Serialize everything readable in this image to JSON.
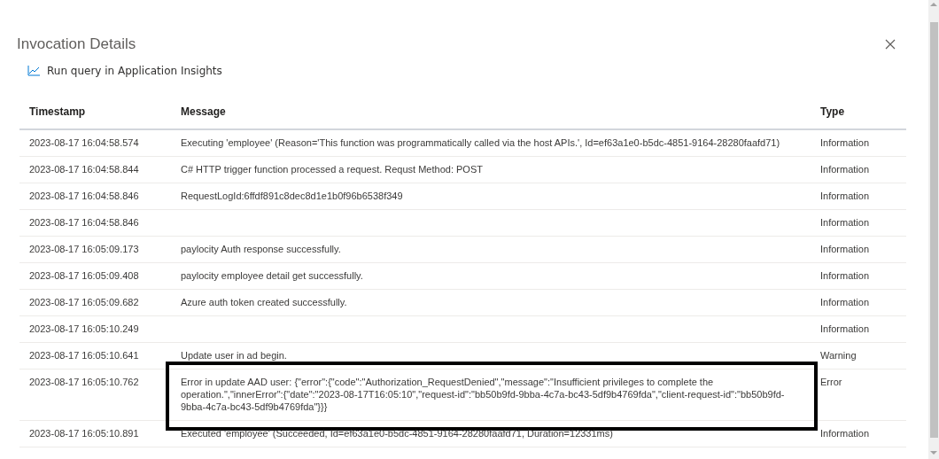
{
  "panel": {
    "title": "Invocation Details",
    "action": "Run query in Application Insights"
  },
  "table": {
    "columns": [
      "Timestamp",
      "Message",
      "Type"
    ],
    "rows": [
      {
        "timestamp": "2023-08-17 16:04:58.574",
        "message": "Executing 'employee' (Reason='This function was programmatically called via the host APIs.', Id=ef63a1e0-b5dc-4851-9164-28280faafd71)",
        "type": "Information",
        "highlighted": false
      },
      {
        "timestamp": "2023-08-17 16:04:58.844",
        "message": "C# HTTP trigger function processed a request. Requst Method: POST",
        "type": "Information",
        "highlighted": false
      },
      {
        "timestamp": "2023-08-17 16:04:58.846",
        "message": "RequestLogId:6ffdf891c8dec8d1e1b0f96b6538f349",
        "type": "Information",
        "highlighted": false
      },
      {
        "timestamp": "2023-08-17 16:04:58.846",
        "type": "Information",
        "highlighted": false
      },
      {
        "timestamp": "2023-08-17 16:05:09.173",
        "message": "paylocity Auth response successfully.",
        "type": "Information",
        "highlighted": false
      },
      {
        "timestamp": "2023-08-17 16:05:09.408",
        "message": "paylocity employee detail get successfully.",
        "type": "Information",
        "highlighted": false
      },
      {
        "timestamp": "2023-08-17 16:05:09.682",
        "message": "Azure auth token created successfully.",
        "type": "Information",
        "highlighted": false
      },
      {
        "timestamp": "2023-08-17 16:05:10.249",
        "type": "Information",
        "highlighted": false
      },
      {
        "timestamp": "2023-08-17 16:05:10.641",
        "message": "Update user in ad begin.",
        "type": "Warning",
        "highlighted": false
      },
      {
        "timestamp": "2023-08-17 16:05:10.762",
        "message": "Error in update AAD user: {\"error\":{\"code\":\"Authorization_RequestDenied\",\"message\":\"Insufficient privileges to complete the operation.\",\"innerError\":{\"date\":\"2023-08-17T16:05:10\",\"request-id\":\"bb50b9fd-9bba-4c7a-bc43-5df9b4769fda\",\"client-request-id\":\"bb50b9fd-9bba-4c7a-bc43-5df9b4769fda\"}}}",
        "type": "Error",
        "highlighted": true
      },
      {
        "timestamp": "2023-08-17 16:05:10.891",
        "message": "Executed 'employee' (Succeeded, Id=ef63a1e0-b5dc-4851-9164-28280faafd71, Duration=12331ms)",
        "type": "Information",
        "highlighted": false
      }
    ]
  }
}
